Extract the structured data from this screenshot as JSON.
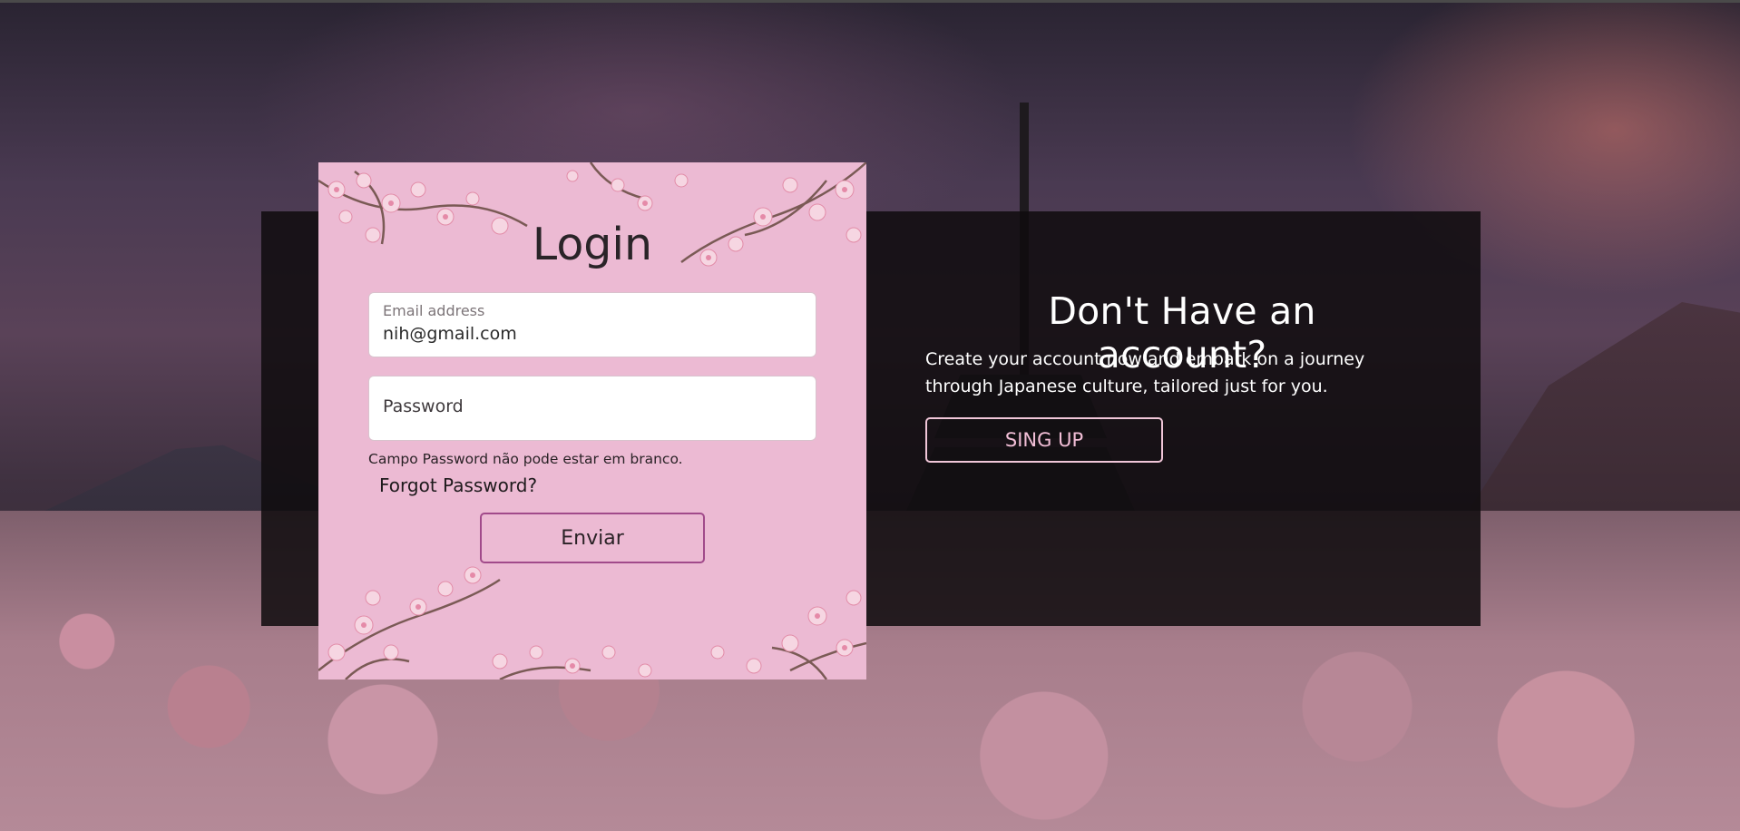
{
  "login": {
    "title": "Login",
    "email": {
      "label": "Email address",
      "value": "nih@gmail.com"
    },
    "password": {
      "placeholder": "Password",
      "value": ""
    },
    "validation_message": "Campo Password não pode estar em branco.",
    "forgot_password": "Forgot Password?",
    "submit_label": "Enviar"
  },
  "signup": {
    "title": "Don't Have an account?",
    "description": "Create your account now and embark on a journey through Japanese culture, tailored just for you.",
    "button_label": "SING UP"
  },
  "colors": {
    "card_background": "#ecbad3",
    "panel_background": "#0f0c0e",
    "signup_button_border": "#f0c6d8",
    "signup_button_text": "#f2bfd7",
    "submit_button_border": "#a14a8a"
  },
  "icons": {
    "card_decoration": "cherry-blossom-branch"
  }
}
